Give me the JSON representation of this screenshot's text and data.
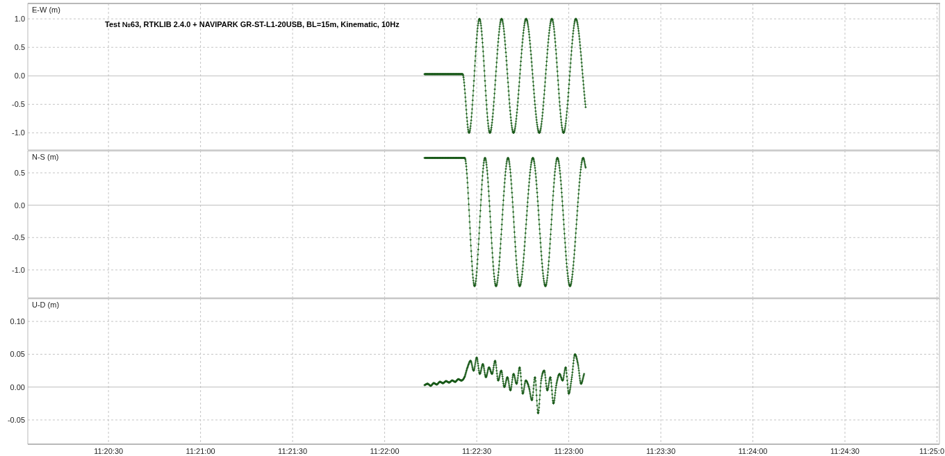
{
  "panels": [
    {
      "chart_data": {
        "type": "line",
        "title": "Test №63, RTKLIB 2.4.0 + NAVIPARK GR-ST-L1-20USB, BL=15m, Kinematic, 10Hz",
        "ylabel": "E-W (m)",
        "grid": true,
        "xlim": [
          40803.7,
          41100.8
        ],
        "ylim": [
          -1.3,
          1.27
        ],
        "yticks": [
          {
            "value": 1,
            "label": "1.0"
          },
          {
            "value": 0.5,
            "label": "0.5"
          },
          {
            "value": 0,
            "label": "0.0"
          },
          {
            "value": -0.5,
            "label": "-0.5"
          },
          {
            "value": -1,
            "label": "-1.0"
          }
        ],
        "series": [
          {
            "color": "#1f7a1f",
            "x": [
              40933,
              40936,
              40939,
              40942,
              40945.4,
              40947.5,
              40950.9,
              40954.3,
              40958.1,
              40962.0,
              40966.1,
              40970.4,
              40974.5,
              40978.3,
              40982.3,
              40985.5
            ],
            "values": [
              0.03,
              0.03,
              0.03,
              0.03,
              0.03,
              -1.0,
              1.0,
              -1.0,
              1.0,
              -1.0,
              1.0,
              -1.0,
              1.0,
              -1.0,
              1.0,
              -0.55
            ]
          }
        ]
      }
    },
    {
      "chart_data": {
        "type": "line",
        "ylabel": "N-S (m)",
        "grid": true,
        "xlim": [
          40803.7,
          41100.8
        ],
        "ylim": [
          -1.43,
          0.843
        ],
        "yticks": [
          {
            "value": 0.5,
            "label": "0.5"
          },
          {
            "value": 0,
            "label": "0.0"
          },
          {
            "value": -0.5,
            "label": "-0.5"
          },
          {
            "value": -1,
            "label": "-1.0"
          }
        ],
        "series": [
          {
            "color": "#1f7a1f",
            "x": [
              40933,
              40936,
              40939,
              40942,
              40946.1,
              40949.3,
              40952.7,
              40956.3,
              40960.2,
              40964.0,
              40968.3,
              40972.4,
              40976.3,
              40980.4,
              40984.7,
              40985.5
            ],
            "values": [
              0.73,
              0.73,
              0.73,
              0.73,
              0.73,
              -1.25,
              0.73,
              -1.25,
              0.73,
              -1.25,
              0.73,
              -1.25,
              0.73,
              -1.25,
              0.73,
              0.58
            ]
          }
        ]
      }
    },
    {
      "chart_data": {
        "type": "line",
        "ylabel": "U-D (m)",
        "xlim": [
          40803.7,
          41100.8
        ],
        "ylim": [
          -0.087,
          0.135
        ],
        "grid": true,
        "xticks": [
          {
            "value": 40830,
            "label": "11:20:30"
          },
          {
            "value": 40860,
            "label": "11:21:00"
          },
          {
            "value": 40890,
            "label": "11:21:30"
          },
          {
            "value": 40920,
            "label": "11:22:00"
          },
          {
            "value": 40950,
            "label": "11:22:30"
          },
          {
            "value": 40980,
            "label": "11:23:00"
          },
          {
            "value": 41010,
            "label": "11:23:30"
          },
          {
            "value": 41040,
            "label": "11:24:00"
          },
          {
            "value": 41070,
            "label": "11:24:30"
          },
          {
            "value": 41100,
            "label": "11:25:0"
          }
        ],
        "yticks": [
          {
            "value": 0.1,
            "label": "0.10"
          },
          {
            "value": 0.05,
            "label": "0.05"
          },
          {
            "value": 0,
            "label": "0.00"
          },
          {
            "value": -0.05,
            "label": "-0.05"
          }
        ],
        "series": [
          {
            "color": "#1f7a1f",
            "x": [
              40933,
              40934,
              40935,
              40936,
              40937,
              40938,
              40939,
              40940,
              40941,
              40942,
              40943,
              40944,
              40945,
              40946,
              40947,
              40948,
              40949,
              40950,
              40951,
              40952,
              40953,
              40954,
              40955,
              40956,
              40957,
              40958,
              40959,
              40960,
              40961,
              40962,
              40963,
              40964,
              40965,
              40966,
              40967,
              40968,
              40969,
              40970,
              40971,
              40972,
              40973,
              40974,
              40975,
              40976,
              40977,
              40978,
              40979,
              40980,
              40981,
              40982,
              40983,
              40984,
              40985
            ],
            "values": [
              0.003,
              0.005,
              0.002,
              0.006,
              0.004,
              0.008,
              0.006,
              0.009,
              0.007,
              0.01,
              0.008,
              0.012,
              0.01,
              0.015,
              0.03,
              0.04,
              0.025,
              0.045,
              0.02,
              0.035,
              0.015,
              0.03,
              0.02,
              0.04,
              0.01,
              0.025,
              0,
              0.015,
              -0.005,
              0.02,
              0.005,
              0.03,
              -0.01,
              0.01,
              0,
              -0.02,
              0.015,
              -0.04,
              0.01,
              0.025,
              -0.005,
              0.015,
              -0.025,
              0.005,
              0.02,
              0.01,
              0.03,
              -0.01,
              0.015,
              0.05,
              0.035,
              0.005,
              0.02
            ]
          }
        ]
      }
    }
  ]
}
